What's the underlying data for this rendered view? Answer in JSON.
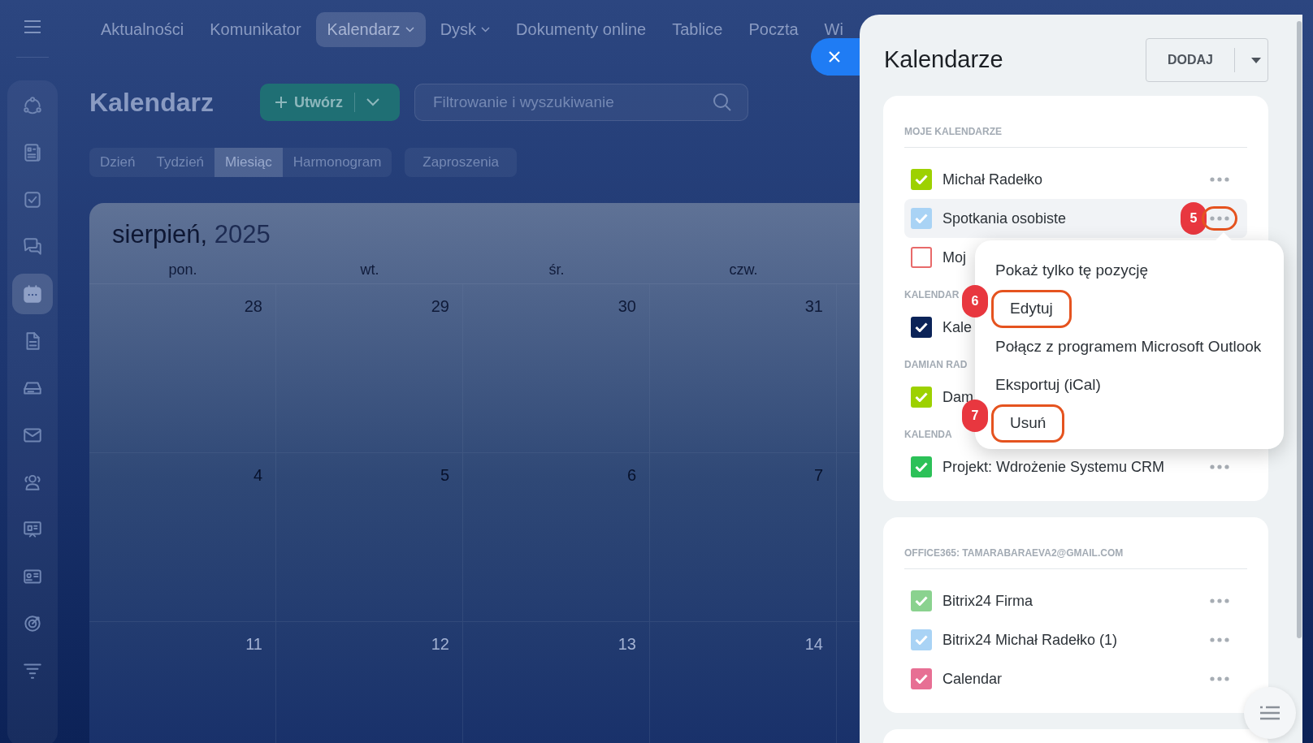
{
  "top_nav": {
    "items": [
      {
        "label": "Aktualności",
        "selected": false,
        "dropdown": false
      },
      {
        "label": "Komunikator",
        "selected": false,
        "dropdown": false
      },
      {
        "label": "Kalendarz",
        "selected": true,
        "dropdown": true
      },
      {
        "label": "Dysk",
        "selected": false,
        "dropdown": true
      },
      {
        "label": "Dokumenty online",
        "selected": false,
        "dropdown": false
      },
      {
        "label": "Tablice",
        "selected": false,
        "dropdown": false
      },
      {
        "label": "Poczta",
        "selected": false,
        "dropdown": false
      },
      {
        "label": "Wi",
        "selected": false,
        "dropdown": false
      }
    ]
  },
  "sidebar": {
    "items": [
      {
        "selected": false
      },
      {
        "selected": false
      },
      {
        "selected": false
      },
      {
        "selected": false
      },
      {
        "selected": true
      },
      {
        "selected": false
      },
      {
        "selected": false
      },
      {
        "selected": false
      },
      {
        "selected": false
      },
      {
        "selected": false
      },
      {
        "selected": false
      },
      {
        "selected": false
      },
      {
        "selected": false
      }
    ]
  },
  "page": {
    "title": "Kalendarz",
    "create_button": "Utwórz",
    "search": {
      "placeholder": "Filtrowanie i wyszukiwanie"
    },
    "view_tabs": [
      {
        "label": "Dzień",
        "selected": false
      },
      {
        "label": "Tydzień",
        "selected": false
      },
      {
        "label": "Miesiąc",
        "selected": true
      },
      {
        "label": "Harmonogram",
        "selected": false
      }
    ],
    "invitations_tab": "Zaproszenia"
  },
  "calendar": {
    "month": "sierpień,",
    "year": "2025",
    "weekdays": [
      "pon.",
      "wt.",
      "śr.",
      "czw."
    ],
    "weeks": [
      [
        "28",
        "29",
        "30",
        "31"
      ],
      [
        "4",
        "5",
        "6",
        "7"
      ],
      [
        "11",
        "12",
        "13",
        "14"
      ]
    ]
  },
  "panel": {
    "title": "Kalendarze",
    "add_button": "DODAJ",
    "cards": [
      {
        "sections": [
          {
            "heading": "MOJE KALENDARZE",
            "items": [
              {
                "name": "Michał Radełko",
                "checked": true,
                "color": "#9dd100",
                "highlighted": false,
                "more_button": true
              },
              {
                "name": "Spotkania osobiste",
                "checked": true,
                "color": "#a9d3f5",
                "highlighted": true,
                "more_button": true,
                "callout": "5"
              },
              {
                "name": "Moj",
                "checked": false,
                "color": "#e86a6a",
                "highlighted": false,
                "more_button": false
              }
            ]
          },
          {
            "heading": "KALENDAR",
            "items": [
              {
                "name": "Kale",
                "checked": true,
                "color": "#0b2358",
                "highlighted": false,
                "more_button": false
              }
            ]
          },
          {
            "heading": "DAMIAN RAD",
            "items": [
              {
                "name": "Dam",
                "checked": true,
                "color": "#9dd100",
                "highlighted": false,
                "more_button": false
              }
            ]
          },
          {
            "heading": "KALENDA",
            "items": [
              {
                "name": "Projekt: Wdrożenie Systemu CRM",
                "checked": true,
                "color": "#2cc158",
                "highlighted": false,
                "more_button": true
              }
            ]
          }
        ]
      },
      {
        "sections": [
          {
            "heading": "OFFICE365: TAMARABARAEVA2@GMAIL.COM",
            "items": [
              {
                "name": "Bitrix24 Firma",
                "checked": true,
                "color": "#8ad28f",
                "highlighted": false,
                "more_button": true
              },
              {
                "name": "Bitrix24 Michał Radełko (1)",
                "checked": true,
                "color": "#a9d3f5",
                "highlighted": false,
                "more_button": true
              },
              {
                "name": "Calendar",
                "checked": true,
                "color": "#e76f94",
                "highlighted": false,
                "more_button": true
              }
            ]
          }
        ]
      }
    ]
  },
  "context_menu": {
    "items": [
      {
        "label": "Pokaż tylko tę pozycję"
      },
      {
        "label": "Edytuj",
        "callout": "6"
      },
      {
        "label": "Połącz z programem Microsoft Outlook"
      },
      {
        "label": "Eksportuj (iCal)"
      },
      {
        "label": "Usuń",
        "callout": "7"
      }
    ]
  }
}
